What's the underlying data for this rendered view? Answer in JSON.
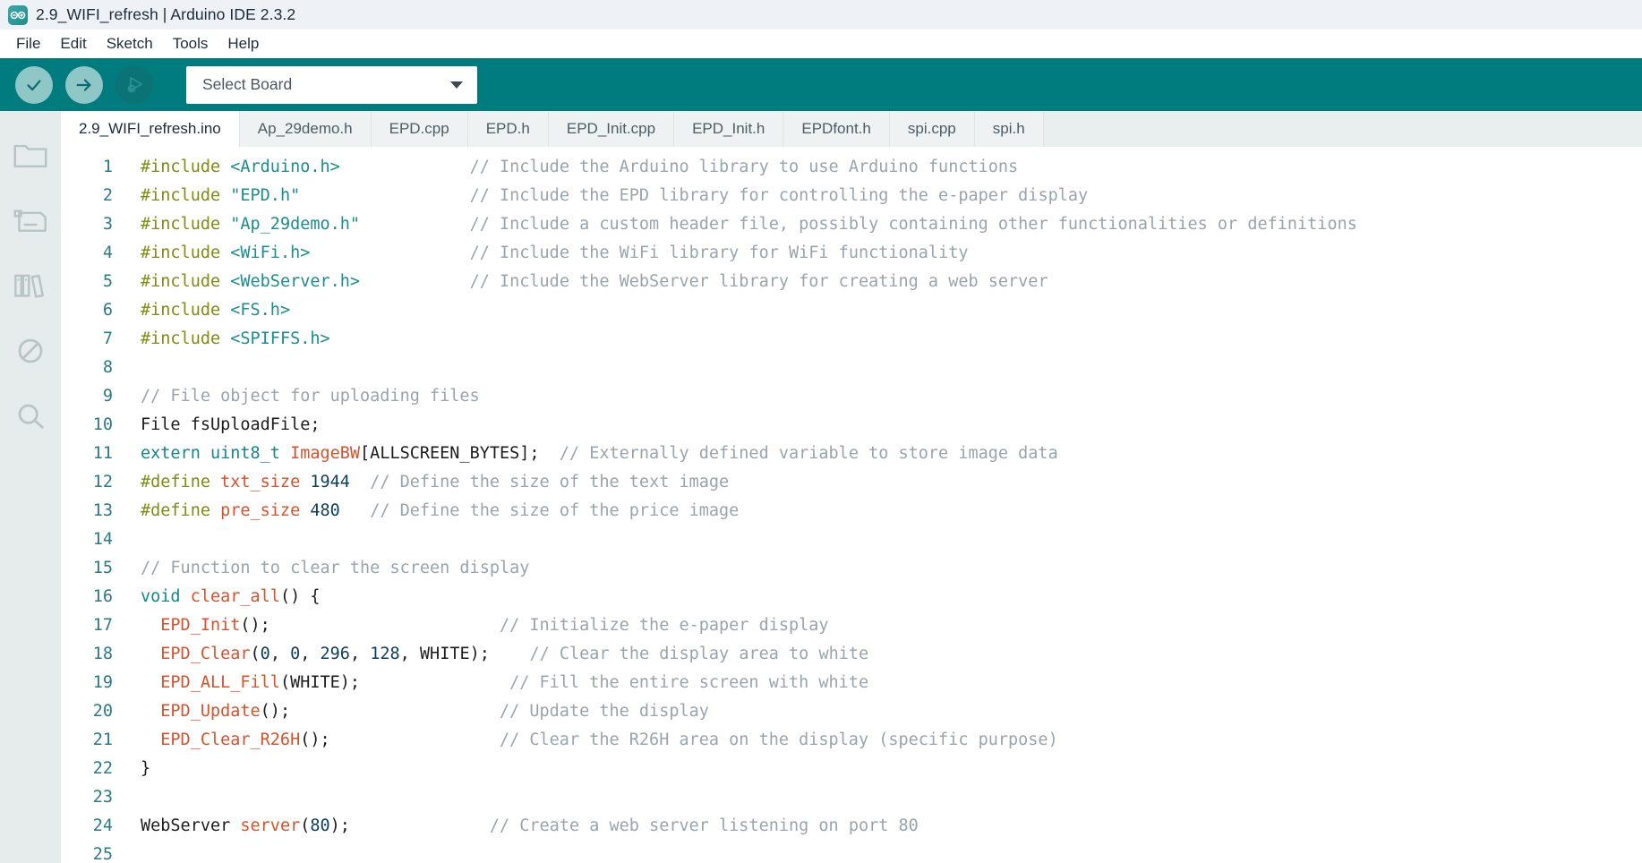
{
  "window": {
    "title": "2.9_WIFI_refresh | Arduino IDE 2.3.2",
    "logo_icon": "arduino-infinity-icon"
  },
  "menu": {
    "items": [
      {
        "label": "File"
      },
      {
        "label": "Edit"
      },
      {
        "label": "Sketch"
      },
      {
        "label": "Tools"
      },
      {
        "label": "Help"
      }
    ]
  },
  "toolbar": {
    "verify_icon": "check-icon",
    "upload_icon": "arrow-right-icon",
    "debug_icon": "debug-play-icon",
    "board_select": {
      "value": "Select Board",
      "caret_icon": "chevron-down-icon"
    },
    "background_color": "#007b7e"
  },
  "activitybar": {
    "items": [
      {
        "icon": "folder-sketchbook-icon",
        "name": "sketchbook"
      },
      {
        "icon": "boards-manager-icon",
        "name": "boards-manager"
      },
      {
        "icon": "library-manager-icon",
        "name": "library-manager"
      },
      {
        "icon": "debug-disabled-icon",
        "name": "debug"
      },
      {
        "icon": "search-icon",
        "name": "search"
      }
    ]
  },
  "tabs": [
    {
      "label": "2.9_WIFI_refresh.ino",
      "active": true
    },
    {
      "label": "Ap_29demo.h",
      "active": false
    },
    {
      "label": "EPD.cpp",
      "active": false
    },
    {
      "label": "EPD.h",
      "active": false
    },
    {
      "label": "EPD_Init.cpp",
      "active": false
    },
    {
      "label": "EPD_Init.h",
      "active": false
    },
    {
      "label": "EPDfont.h",
      "active": false
    },
    {
      "label": "spi.cpp",
      "active": false
    },
    {
      "label": "spi.h",
      "active": false
    }
  ],
  "editor": {
    "lines": [
      {
        "n": "1",
        "tokens": [
          {
            "t": "pre",
            "s": "#include "
          },
          {
            "t": "str",
            "s": "<Arduino.h>"
          },
          {
            "t": "plain",
            "s": "             "
          },
          {
            "t": "cmt",
            "s": "// Include the Arduino library to use Arduino functions"
          }
        ]
      },
      {
        "n": "2",
        "tokens": [
          {
            "t": "pre",
            "s": "#include "
          },
          {
            "t": "str",
            "s": "\"EPD.h\""
          },
          {
            "t": "plain",
            "s": "                 "
          },
          {
            "t": "cmt",
            "s": "// Include the EPD library for controlling the e-paper display"
          }
        ]
      },
      {
        "n": "3",
        "tokens": [
          {
            "t": "pre",
            "s": "#include "
          },
          {
            "t": "str",
            "s": "\"Ap_29demo.h\""
          },
          {
            "t": "plain",
            "s": "           "
          },
          {
            "t": "cmt",
            "s": "// Include a custom header file, possibly containing other functionalities or definitions"
          }
        ]
      },
      {
        "n": "4",
        "tokens": [
          {
            "t": "pre",
            "s": "#include "
          },
          {
            "t": "str",
            "s": "<WiFi.h>"
          },
          {
            "t": "plain",
            "s": "                "
          },
          {
            "t": "cmt",
            "s": "// Include the WiFi library for WiFi functionality"
          }
        ]
      },
      {
        "n": "5",
        "tokens": [
          {
            "t": "pre",
            "s": "#include "
          },
          {
            "t": "str",
            "s": "<WebServer.h>"
          },
          {
            "t": "plain",
            "s": "           "
          },
          {
            "t": "cmt",
            "s": "// Include the WebServer library for creating a web server"
          }
        ]
      },
      {
        "n": "6",
        "tokens": [
          {
            "t": "pre",
            "s": "#include "
          },
          {
            "t": "str",
            "s": "<FS.h>"
          }
        ]
      },
      {
        "n": "7",
        "tokens": [
          {
            "t": "pre",
            "s": "#include "
          },
          {
            "t": "str",
            "s": "<SPIFFS.h>"
          }
        ]
      },
      {
        "n": "8",
        "tokens": []
      },
      {
        "n": "9",
        "tokens": [
          {
            "t": "cmt",
            "s": "// File object for uploading files"
          }
        ]
      },
      {
        "n": "10",
        "tokens": [
          {
            "t": "plain",
            "s": "File fsUploadFile;"
          }
        ]
      },
      {
        "n": "11",
        "tokens": [
          {
            "t": "kw",
            "s": "extern"
          },
          {
            "t": "plain",
            "s": " "
          },
          {
            "t": "type",
            "s": "uint8_t"
          },
          {
            "t": "plain",
            "s": " "
          },
          {
            "t": "id",
            "s": "ImageBW"
          },
          {
            "t": "plain",
            "s": "[ALLSCREEN_BYTES];  "
          },
          {
            "t": "cmt",
            "s": "// Externally defined variable to store image data"
          }
        ]
      },
      {
        "n": "12",
        "tokens": [
          {
            "t": "pre",
            "s": "#define"
          },
          {
            "t": "plain",
            "s": " "
          },
          {
            "t": "id",
            "s": "txt_size"
          },
          {
            "t": "plain",
            "s": " "
          },
          {
            "t": "num",
            "s": "1944"
          },
          {
            "t": "plain",
            "s": "  "
          },
          {
            "t": "cmt",
            "s": "// Define the size of the text image"
          }
        ]
      },
      {
        "n": "13",
        "tokens": [
          {
            "t": "pre",
            "s": "#define"
          },
          {
            "t": "plain",
            "s": " "
          },
          {
            "t": "id",
            "s": "pre_size"
          },
          {
            "t": "plain",
            "s": " "
          },
          {
            "t": "num",
            "s": "480"
          },
          {
            "t": "plain",
            "s": "   "
          },
          {
            "t": "cmt",
            "s": "// Define the size of the price image"
          }
        ]
      },
      {
        "n": "14",
        "tokens": []
      },
      {
        "n": "15",
        "tokens": [
          {
            "t": "cmt",
            "s": "// Function to clear the screen display"
          }
        ]
      },
      {
        "n": "16",
        "tokens": [
          {
            "t": "kw",
            "s": "void"
          },
          {
            "t": "plain",
            "s": " "
          },
          {
            "t": "fn",
            "s": "clear_all"
          },
          {
            "t": "plain",
            "s": "() {"
          }
        ]
      },
      {
        "n": "17",
        "tokens": [
          {
            "t": "plain",
            "s": "  "
          },
          {
            "t": "fn",
            "s": "EPD_Init"
          },
          {
            "t": "plain",
            "s": "();                       "
          },
          {
            "t": "cmt",
            "s": "// Initialize the e-paper display"
          }
        ]
      },
      {
        "n": "18",
        "tokens": [
          {
            "t": "plain",
            "s": "  "
          },
          {
            "t": "fn",
            "s": "EPD_Clear"
          },
          {
            "t": "plain",
            "s": "("
          },
          {
            "t": "num",
            "s": "0"
          },
          {
            "t": "plain",
            "s": ", "
          },
          {
            "t": "num",
            "s": "0"
          },
          {
            "t": "plain",
            "s": ", "
          },
          {
            "t": "num",
            "s": "296"
          },
          {
            "t": "plain",
            "s": ", "
          },
          {
            "t": "num",
            "s": "128"
          },
          {
            "t": "plain",
            "s": ", WHITE);    "
          },
          {
            "t": "cmt",
            "s": "// Clear the display area to white"
          }
        ]
      },
      {
        "n": "19",
        "tokens": [
          {
            "t": "plain",
            "s": "  "
          },
          {
            "t": "fn",
            "s": "EPD_ALL_Fill"
          },
          {
            "t": "plain",
            "s": "(WHITE);               "
          },
          {
            "t": "cmt",
            "s": "// Fill the entire screen with white"
          }
        ]
      },
      {
        "n": "20",
        "tokens": [
          {
            "t": "plain",
            "s": "  "
          },
          {
            "t": "fn",
            "s": "EPD_Update"
          },
          {
            "t": "plain",
            "s": "();                     "
          },
          {
            "t": "cmt",
            "s": "// Update the display"
          }
        ]
      },
      {
        "n": "21",
        "tokens": [
          {
            "t": "plain",
            "s": "  "
          },
          {
            "t": "fn",
            "s": "EPD_Clear_R26H"
          },
          {
            "t": "plain",
            "s": "();                 "
          },
          {
            "t": "cmt",
            "s": "// Clear the R26H area on the display (specific purpose)"
          }
        ]
      },
      {
        "n": "22",
        "tokens": [
          {
            "t": "plain",
            "s": "}"
          }
        ]
      },
      {
        "n": "23",
        "tokens": []
      },
      {
        "n": "24",
        "tokens": [
          {
            "t": "plain",
            "s": "WebServer "
          },
          {
            "t": "fn",
            "s": "server"
          },
          {
            "t": "plain",
            "s": "("
          },
          {
            "t": "num",
            "s": "80"
          },
          {
            "t": "plain",
            "s": ");              "
          },
          {
            "t": "cmt",
            "s": "// Create a web server listening on port 80"
          }
        ]
      },
      {
        "n": "25",
        "tokens": []
      }
    ],
    "colors": {
      "preprocessor": "#7f8c12",
      "string": "#1a8e8e",
      "comment": "#9aa4ab",
      "keyword": "#14878a",
      "function": "#d9522b",
      "number": "#0d3f5c",
      "plain": "#1c1c1c",
      "gutter": "#2b7a87"
    }
  }
}
